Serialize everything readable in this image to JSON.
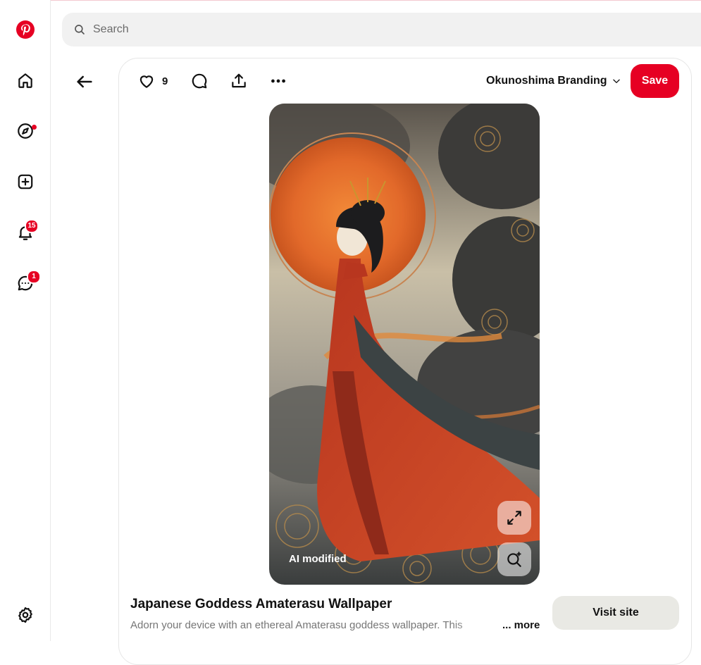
{
  "search": {
    "placeholder": "Search"
  },
  "sidebar": {
    "notifications_badge": "15",
    "messages_badge": "1"
  },
  "pin": {
    "like_count": "9",
    "board_name": "Okunoshima Branding",
    "save_label": "Save",
    "image_label": "AI modified",
    "title": "Japanese Goddess Amaterasu Wallpaper",
    "description": "Adorn your device with an ethereal Amaterasu goddess wallpaper. This",
    "more_label": "... more",
    "visit_label": "Visit site"
  },
  "colors": {
    "accent": "#e60023",
    "secondary_button": "#e9e9e4"
  }
}
